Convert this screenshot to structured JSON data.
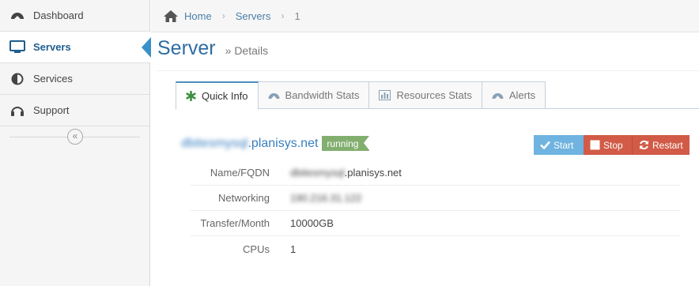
{
  "sidebar": {
    "items": [
      {
        "label": "Dashboard",
        "icon": "dashboard-icon"
      },
      {
        "label": "Servers",
        "icon": "monitor-icon",
        "active": true
      },
      {
        "label": "Services",
        "icon": "adjust-icon"
      },
      {
        "label": "Support",
        "icon": "headphones-icon"
      }
    ],
    "collapse_glyph": "«"
  },
  "breadcrumb": {
    "home": "Home",
    "servers": "Servers",
    "current": "1"
  },
  "header": {
    "title": "Server",
    "subtitle": "» Details"
  },
  "tabs": [
    {
      "label": "Quick Info",
      "icon": "asterisk-icon",
      "active": true
    },
    {
      "label": "Bandwidth Stats",
      "icon": "dashboard-icon"
    },
    {
      "label": "Resources Stats",
      "icon": "bar-chart-icon"
    },
    {
      "label": "Alerts",
      "icon": "dashboard-icon"
    }
  ],
  "server": {
    "name_prefix": "dbitesmysql",
    "name_suffix": ".planisys.net",
    "status": "running"
  },
  "actions": {
    "start": "Start",
    "stop": "Stop",
    "restart": "Restart"
  },
  "details": [
    {
      "label": "Name/FQDN",
      "value_prefix": "dbitesmysql",
      "value": ".planisys.net"
    },
    {
      "label": "Networking",
      "value_prefix": "190.216.31.122",
      "value": ""
    },
    {
      "label": "Transfer/Month",
      "value_prefix": "",
      "value": "10000GB"
    },
    {
      "label": "CPUs",
      "value_prefix": "",
      "value": "1"
    }
  ],
  "colors": {
    "accent": "#2e6da4",
    "start": "#6fb3e0",
    "stop": "#d15b47",
    "running": "#82af6f"
  }
}
